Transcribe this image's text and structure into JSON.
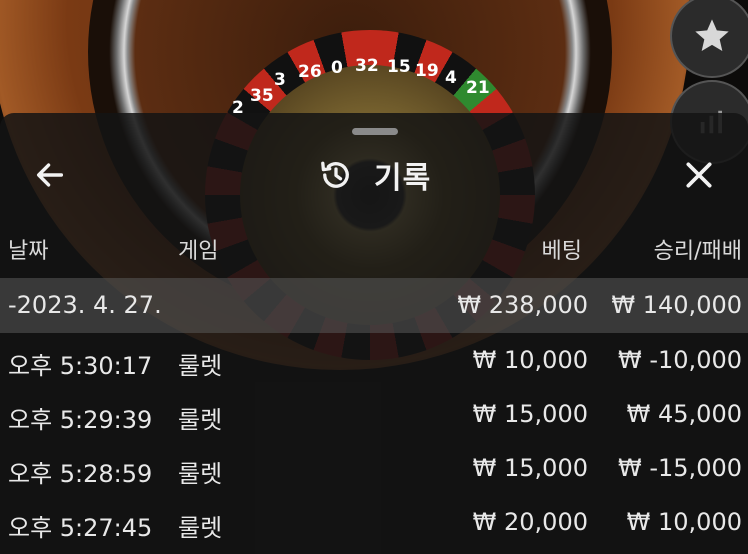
{
  "wheel": {
    "numbers": [
      "3",
      "26",
      "0",
      "32",
      "15",
      "19",
      "4",
      "21",
      "2",
      "35"
    ]
  },
  "side": {
    "favorite_icon": "star-icon",
    "stats_icon": "bar-chart-icon"
  },
  "header": {
    "back_icon": "arrow-left-icon",
    "history_icon": "history-icon",
    "title": "기록",
    "close_icon": "close-icon"
  },
  "columns": {
    "date": "날짜",
    "game": "게임",
    "bet": "베팅",
    "result": "승리/패배"
  },
  "summary": {
    "date": "-2023. 4. 27.",
    "bet": "₩ 238,000",
    "result": "₩ 140,000"
  },
  "rows": [
    {
      "time": "오후 5:30:17",
      "game": "룰렛",
      "bet": "₩ 10,000",
      "result": "₩ -10,000"
    },
    {
      "time": "오후 5:29:39",
      "game": "룰렛",
      "bet": "₩ 15,000",
      "result": "₩ 45,000"
    },
    {
      "time": "오후 5:28:59",
      "game": "룰렛",
      "bet": "₩ 15,000",
      "result": "₩ -15,000"
    },
    {
      "time": "오후 5:27:45",
      "game": "룰렛",
      "bet": "₩ 20,000",
      "result": "₩ 10,000"
    }
  ],
  "colors": {
    "panel_bg": "#141414",
    "summary_bg": "#5a5a5a",
    "text": "#e8e8e8"
  }
}
